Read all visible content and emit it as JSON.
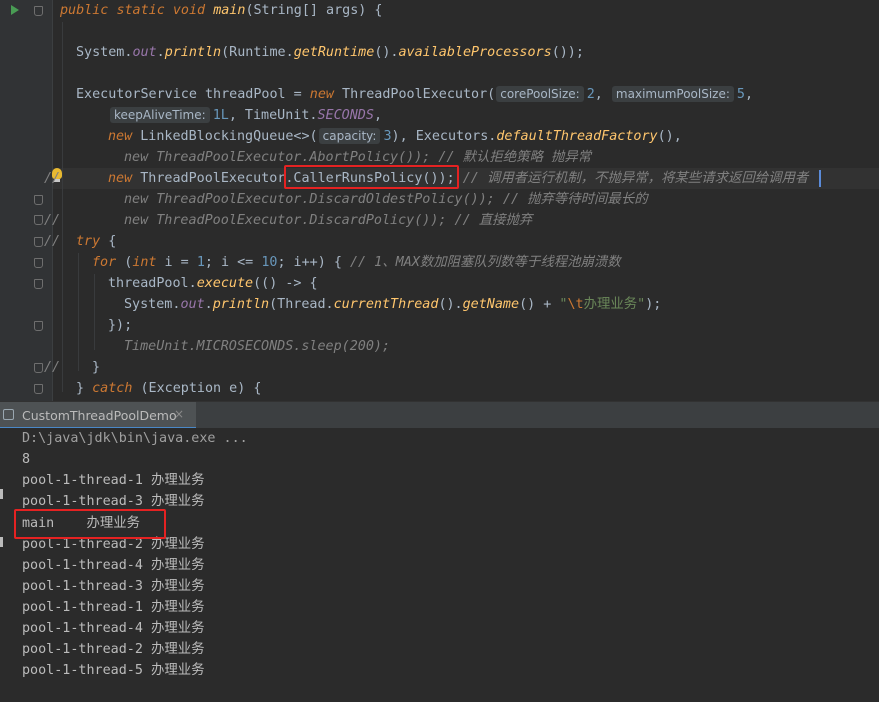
{
  "editor": {
    "line1": {
      "kw1": "public",
      "kw2": "static",
      "kw3": "void",
      "name": "main",
      "params": "(String[] args) {"
    },
    "line2": {
      "cls": "System.",
      "field": "out",
      "dot": ".",
      "call": "println",
      "p1": "(Runtime.",
      "call2": "getRuntime",
      "p2": "().",
      "call3": "availableProcessors",
      "p3": "());"
    },
    "line3": {
      "t1": "ExecutorService threadPool = ",
      "kw": "new",
      "t2": " ThreadPoolExecutor(",
      "hint1": "corePoolSize:",
      "v1": "2",
      "t3": ", ",
      "hint2": "maximumPoolSize:",
      "v2": "5",
      "t4": ","
    },
    "line4": {
      "hint": "keepAliveTime:",
      "v": "1L",
      "t1": ", TimeUnit.",
      "field": "SECONDS",
      "t2": ","
    },
    "line5": {
      "kw": "new",
      "t1": " LinkedBlockingQueue<>(",
      "hint": "capacity:",
      "v": "3",
      "t2": "), Executors.",
      "call": "defaultThreadFactory",
      "t3": "(),"
    },
    "line6": {
      "slash": "//",
      "text": "new ThreadPoolExecutor.AbortPolicy()); // 默认拒绝策略 抛异常"
    },
    "line7": {
      "kw": "new",
      "t1": " ThreadPoolExecutor",
      "t2": ".CallerRunsPolicy());",
      "comment": "// 调用者运行机制，不抛异常，将某些请求返回给调用者"
    },
    "line8": {
      "slash": "//",
      "text": "new ThreadPoolExecutor.DiscardOldestPolicy()); // 抛弃等待时间最长的"
    },
    "line9": {
      "slash": "//",
      "text": "new ThreadPoolExecutor.DiscardPolicy()); // 直接抛弃"
    },
    "line10": {
      "kw": "try",
      "t": " {"
    },
    "line11": {
      "kw": "for",
      "t1": " (",
      "kw2": "int",
      "t2": " i = ",
      "n1": "1",
      "t3": "; i <= ",
      "n2": "10",
      "t4": "; i++) { ",
      "comment": "// 1、MAX数加阻塞队列数等于线程池崩溃数"
    },
    "line12": {
      "t1": "threadPool.",
      "call": "execute",
      "t2": "(() -> {"
    },
    "line13": {
      "cls": "System.",
      "field": "out",
      "dot": ".",
      "call": "println",
      "t1": "(Thread.",
      "call2": "currentThread",
      "t2": "().",
      "call3": "getName",
      "t3": "() + ",
      "str1": "\"",
      "esc": "\\t",
      "str2": "办理业务\"",
      "t4": ");"
    },
    "line14": {
      "t": "});"
    },
    "line15": {
      "slash": "//",
      "text": "TimeUnit.MICROSECONDS.sleep(200);"
    },
    "line16": {
      "t": "}"
    },
    "line17": {
      "t1": "} ",
      "kw": "catch",
      "t2": " (Exception e) {"
    }
  },
  "run_tab": {
    "label": "CustomThreadPoolDemo",
    "close": "×"
  },
  "console": {
    "command": "D:\\java\\jdk\\bin\\java.exe ...",
    "lines": [
      "8",
      "pool-1-thread-1 办理业务",
      "pool-1-thread-3 办理业务",
      "main\t办理业务",
      "pool-1-thread-2 办理业务",
      "pool-1-thread-4 办理业务",
      "pool-1-thread-3 办理业务",
      "pool-1-thread-1 办理业务",
      "pool-1-thread-4 办理业务",
      "pool-1-thread-2 办理业务",
      "pool-1-thread-5 办理业务"
    ]
  },
  "colors": {
    "highlight_box": "#e52222",
    "keyword": "#cc7832",
    "method": "#ffc66d",
    "field": "#9876aa",
    "number": "#6897bb",
    "string": "#6a8759",
    "comment": "#629755"
  }
}
